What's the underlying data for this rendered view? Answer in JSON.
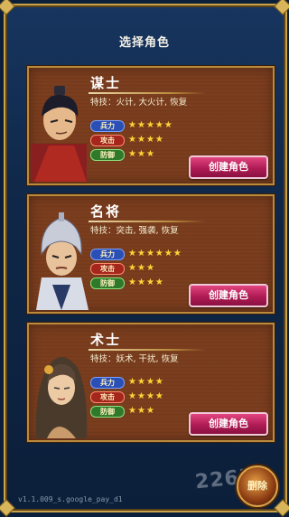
{
  "header": {
    "title": "选择角色"
  },
  "colors": {
    "accent_gold": "#c9a24a",
    "card_bg": "#7a3d1e",
    "button_pink": "#b01c55"
  },
  "stat_labels": {
    "power": "兵力",
    "attack": "攻击",
    "defense": "防御"
  },
  "characters": [
    {
      "name": "谋士",
      "skill": "特技：火计, 大火计, 恢复",
      "power_stars": 5,
      "attack_stars": 4,
      "defense_stars": 3,
      "button": "创建角色"
    },
    {
      "name": "名将",
      "skill": "特技：突击, 强袭, 恢复",
      "power_stars": 6,
      "attack_stars": 3,
      "defense_stars": 4,
      "button": "创建角色"
    },
    {
      "name": "术士",
      "skill": "特技：妖术, 干扰, 恢复",
      "power_stars": 4,
      "attack_stars": 4,
      "defense_stars": 3,
      "button": "创建角色"
    }
  ],
  "delete_button": "删除",
  "version": "v1.1.009_s.google_pay_d1",
  "watermark": "2265"
}
